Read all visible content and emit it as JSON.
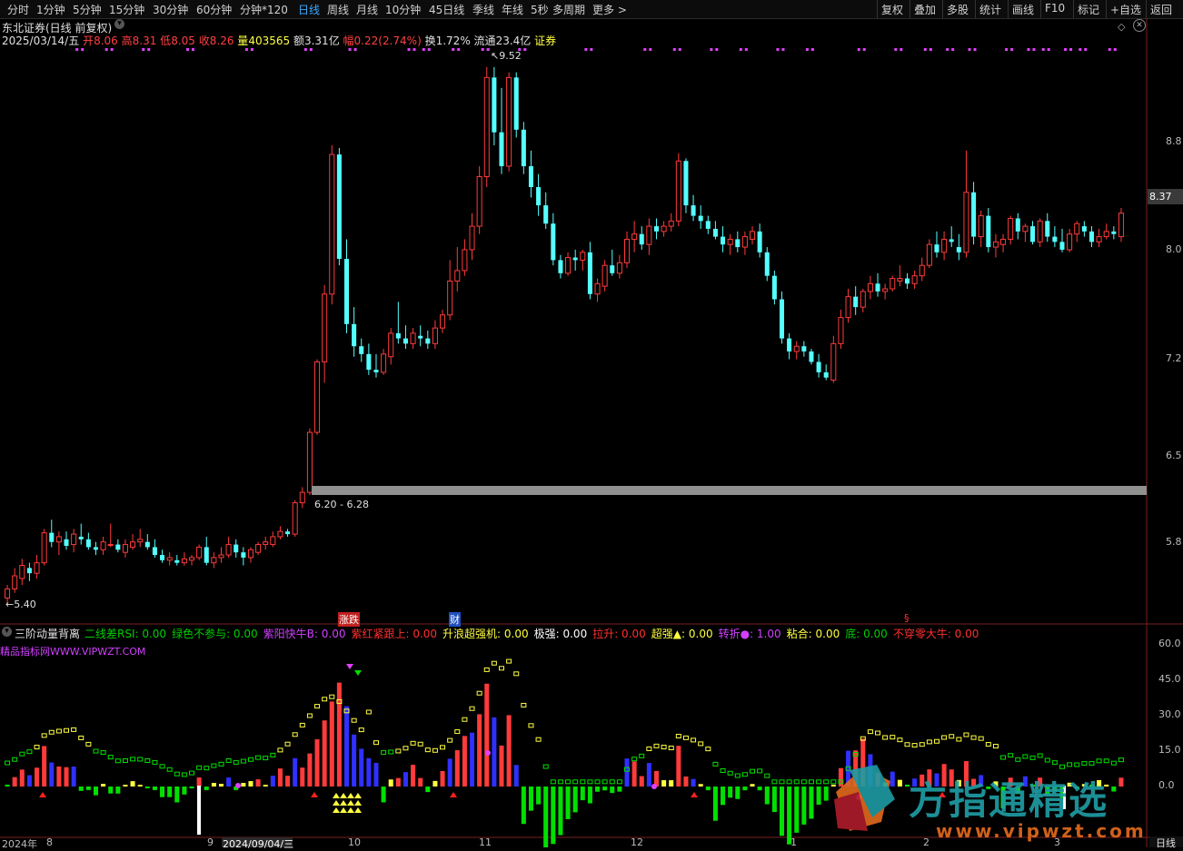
{
  "toolbar": {
    "left_items": [
      "分时",
      "1分钟",
      "5分钟",
      "15分钟",
      "30分钟",
      "60分钟",
      "分钟*120",
      "日线",
      "周线",
      "月线",
      "10分钟",
      "45日线",
      "季线",
      "年线",
      "5秒",
      "多周期",
      "更多 >"
    ],
    "active_index": 7,
    "right_items": [
      "复权",
      "叠加",
      "多股",
      "统计",
      "画线",
      "F10",
      "标记",
      "+自选",
      "返回"
    ]
  },
  "stock": {
    "title": "东北证券(日线 前复权)",
    "date": "2025/03/14/五",
    "open_label": "开",
    "open": "8.06",
    "high_label": "高",
    "high": "8.31",
    "low_label": "低",
    "low": "8.05",
    "close_label": "收",
    "close": "8.26",
    "volume_label": "量",
    "volume": "403565",
    "amount_label": "额",
    "amount": "3.31亿",
    "change_label": "幅",
    "change": "0.22(2.74%)",
    "turnover_label": "换",
    "turnover": "1.72%",
    "float_label": "流通",
    "float": "23.4亿",
    "sector": "证券"
  },
  "price_chart": {
    "type": "candlestick",
    "y_ticks": [
      "8.8",
      "8.37",
      "8.0",
      "7.2",
      "6.5",
      "5.8"
    ],
    "current_price": "8.37",
    "high_marker": "9.52",
    "low_marker": "5.40",
    "support_band": "6.20 - 6.28",
    "event_markers": [
      "涨跌",
      "财",
      "§"
    ]
  },
  "indicator": {
    "name": "三阶动量背离",
    "legend": [
      {
        "text": "二线差RSI: 0.00",
        "color": "#00d000"
      },
      {
        "text": "绿色不参与: 0.00",
        "color": "#00d000"
      },
      {
        "text": "紫阳快牛B: 0.00",
        "color": "#d040ff"
      },
      {
        "text": "紫红紧跟上: 0.00",
        "color": "#ff3030"
      },
      {
        "text": "升浪超强机: 0.00",
        "color": "#ffff40"
      },
      {
        "text": "极强: 0.00",
        "color": "#ffffff"
      },
      {
        "text": "拉升: 0.00",
        "color": "#ff3030"
      },
      {
        "text": "超强▲: 0.00",
        "color": "#ffff40"
      },
      {
        "text": "转折●: 1.00",
        "color": "#d040ff"
      },
      {
        "text": "粘合: 0.00",
        "color": "#ffff40"
      },
      {
        "text": "底: 0.00",
        "color": "#00d000"
      },
      {
        "text": "不穿零大牛: 0.00",
        "color": "#ff3030"
      }
    ],
    "watermark": "精品指标网WWW.VIPWZT.COM",
    "y_ticks": [
      "60.0",
      "45.0",
      "30.0",
      "15.0",
      "0.0"
    ]
  },
  "x_axis": {
    "labels": [
      "2024年",
      "8",
      "9",
      "2024/09/04/三",
      "10",
      "11",
      "12",
      "1",
      "2",
      "3"
    ],
    "period": "日线"
  },
  "watermark_logo": {
    "title": "方指通精选",
    "url": "www.vipwzt.com"
  },
  "colors": {
    "up": "#ff3b3b",
    "down": "#54ffff",
    "yellow": "#ffff40",
    "green": "#00e000",
    "magenta": "#e040ff",
    "blue": "#3030ff"
  },
  "chart_data": {
    "type": "candlestick",
    "ohlc": [
      [
        5.45,
        5.55,
        5.4,
        5.52
      ],
      [
        5.52,
        5.68,
        5.49,
        5.62
      ],
      [
        5.6,
        5.75,
        5.55,
        5.7
      ],
      [
        5.68,
        5.72,
        5.58,
        5.64
      ],
      [
        5.64,
        5.78,
        5.6,
        5.72
      ],
      [
        5.72,
        5.98,
        5.7,
        5.95
      ],
      [
        5.95,
        6.05,
        5.84,
        5.88
      ],
      [
        5.88,
        5.96,
        5.78,
        5.92
      ],
      [
        5.9,
        5.96,
        5.82,
        5.85
      ],
      [
        5.86,
        5.98,
        5.8,
        5.94
      ],
      [
        5.92,
        6.02,
        5.86,
        5.9
      ],
      [
        5.9,
        5.95,
        5.82,
        5.84
      ],
      [
        5.84,
        5.88,
        5.78,
        5.82
      ],
      [
        5.82,
        5.92,
        5.78,
        5.88
      ],
      [
        5.86,
        6.02,
        5.84,
        5.86
      ],
      [
        5.86,
        5.9,
        5.8,
        5.82
      ],
      [
        5.8,
        5.9,
        5.76,
        5.86
      ],
      [
        5.84,
        5.94,
        5.82,
        5.88
      ],
      [
        5.88,
        5.98,
        5.84,
        5.9
      ],
      [
        5.88,
        5.94,
        5.82,
        5.84
      ],
      [
        5.84,
        5.9,
        5.76,
        5.78
      ],
      [
        5.78,
        5.82,
        5.72,
        5.74
      ],
      [
        5.74,
        5.8,
        5.7,
        5.76
      ],
      [
        5.74,
        5.78,
        5.7,
        5.72
      ],
      [
        5.72,
        5.8,
        5.7,
        5.75
      ],
      [
        5.74,
        5.78,
        5.7,
        5.76
      ],
      [
        5.76,
        5.86,
        5.74,
        5.84
      ],
      [
        5.84,
        5.92,
        5.7,
        5.72
      ],
      [
        5.72,
        5.8,
        5.68,
        5.76
      ],
      [
        5.76,
        5.84,
        5.72,
        5.78
      ],
      [
        5.78,
        5.92,
        5.76,
        5.86
      ],
      [
        5.86,
        5.9,
        5.76,
        5.8
      ],
      [
        5.8,
        5.84,
        5.7,
        5.76
      ],
      [
        5.76,
        5.84,
        5.72,
        5.82
      ],
      [
        5.8,
        5.88,
        5.78,
        5.86
      ],
      [
        5.86,
        5.92,
        5.82,
        5.88
      ],
      [
        5.86,
        5.96,
        5.84,
        5.92
      ],
      [
        5.92,
        6.0,
        5.9,
        5.96
      ],
      [
        5.96,
        5.98,
        5.92,
        5.94
      ],
      [
        5.94,
        6.2,
        5.92,
        6.18
      ],
      [
        6.18,
        6.3,
        6.14,
        6.26
      ],
      [
        6.26,
        6.75,
        6.24,
        6.72
      ],
      [
        6.72,
        7.28,
        6.7,
        7.26
      ],
      [
        7.26,
        7.85,
        7.1,
        7.78
      ],
      [
        7.78,
        8.92,
        7.7,
        8.85
      ],
      [
        8.85,
        8.9,
        8.0,
        8.05
      ],
      [
        8.05,
        8.2,
        7.48,
        7.55
      ],
      [
        7.55,
        7.68,
        7.3,
        7.38
      ],
      [
        7.38,
        7.44,
        7.26,
        7.32
      ],
      [
        7.32,
        7.4,
        7.16,
        7.2
      ],
      [
        7.2,
        7.32,
        7.14,
        7.18
      ],
      [
        7.18,
        7.36,
        7.16,
        7.32
      ],
      [
        7.3,
        7.52,
        7.24,
        7.48
      ],
      [
        7.48,
        7.72,
        7.4,
        7.44
      ],
      [
        7.44,
        7.54,
        7.36,
        7.4
      ],
      [
        7.4,
        7.52,
        7.36,
        7.48
      ],
      [
        7.46,
        7.54,
        7.38,
        7.44
      ],
      [
        7.44,
        7.5,
        7.36,
        7.4
      ],
      [
        7.4,
        7.58,
        7.36,
        7.52
      ],
      [
        7.52,
        7.66,
        7.48,
        7.62
      ],
      [
        7.62,
        8.04,
        7.58,
        7.88
      ],
      [
        7.88,
        8.14,
        7.8,
        7.96
      ],
      [
        7.96,
        8.2,
        7.92,
        8.12
      ],
      [
        8.12,
        8.4,
        8.04,
        8.3
      ],
      [
        8.3,
        8.76,
        8.24,
        8.68
      ],
      [
        8.68,
        9.52,
        8.6,
        9.44
      ],
      [
        9.44,
        9.52,
        8.92,
        9.02
      ],
      [
        9.02,
        9.36,
        8.7,
        8.76
      ],
      [
        8.76,
        9.48,
        8.72,
        9.44
      ],
      [
        9.44,
        9.48,
        8.98,
        9.04
      ],
      [
        9.04,
        9.1,
        8.7,
        8.76
      ],
      [
        8.76,
        8.88,
        8.52,
        8.6
      ],
      [
        8.6,
        8.7,
        8.38,
        8.46
      ],
      [
        8.46,
        8.56,
        8.28,
        8.32
      ],
      [
        8.32,
        8.4,
        8.0,
        8.04
      ],
      [
        8.04,
        8.08,
        7.9,
        7.94
      ],
      [
        7.94,
        8.1,
        7.92,
        8.06
      ],
      [
        8.06,
        8.12,
        7.96,
        8.04
      ],
      [
        8.04,
        8.12,
        7.96,
        8.1
      ],
      [
        8.1,
        8.18,
        7.74,
        7.78
      ],
      [
        7.78,
        7.9,
        7.72,
        7.86
      ],
      [
        7.84,
        8.04,
        7.8,
        8.0
      ],
      [
        8.0,
        8.12,
        7.92,
        7.94
      ],
      [
        7.94,
        8.08,
        7.9,
        8.02
      ],
      [
        8.02,
        8.26,
        7.98,
        8.2
      ],
      [
        8.2,
        8.34,
        8.1,
        8.24
      ],
      [
        8.24,
        8.3,
        8.12,
        8.16
      ],
      [
        8.16,
        8.36,
        8.08,
        8.3
      ],
      [
        8.3,
        8.36,
        8.2,
        8.26
      ],
      [
        8.26,
        8.34,
        8.22,
        8.3
      ],
      [
        8.3,
        8.4,
        8.26,
        8.34
      ],
      [
        8.34,
        8.86,
        8.3,
        8.8
      ],
      [
        8.8,
        8.82,
        8.4,
        8.46
      ],
      [
        8.46,
        8.54,
        8.34,
        8.38
      ],
      [
        8.38,
        8.46,
        8.28,
        8.34
      ],
      [
        8.34,
        8.38,
        8.24,
        8.28
      ],
      [
        8.28,
        8.34,
        8.2,
        8.22
      ],
      [
        8.22,
        8.3,
        8.1,
        8.16
      ],
      [
        8.16,
        8.24,
        8.08,
        8.2
      ],
      [
        8.2,
        8.26,
        8.1,
        8.14
      ],
      [
        8.14,
        8.26,
        8.08,
        8.22
      ],
      [
        8.2,
        8.3,
        8.16,
        8.26
      ],
      [
        8.26,
        8.32,
        8.06,
        8.1
      ],
      [
        8.1,
        8.14,
        7.88,
        7.92
      ],
      [
        7.92,
        7.96,
        7.7,
        7.74
      ],
      [
        7.74,
        7.8,
        7.4,
        7.44
      ],
      [
        7.44,
        7.48,
        7.28,
        7.34
      ],
      [
        7.34,
        7.42,
        7.28,
        7.38
      ],
      [
        7.38,
        7.42,
        7.3,
        7.34
      ],
      [
        7.34,
        7.36,
        7.24,
        7.26
      ],
      [
        7.26,
        7.32,
        7.14,
        7.18
      ],
      [
        7.18,
        7.24,
        7.12,
        7.14
      ],
      [
        7.12,
        7.46,
        7.1,
        7.4
      ],
      [
        7.4,
        7.66,
        7.36,
        7.6
      ],
      [
        7.6,
        7.82,
        7.56,
        7.76
      ],
      [
        7.76,
        7.84,
        7.62,
        7.68
      ],
      [
        7.68,
        7.82,
        7.64,
        7.8
      ],
      [
        7.8,
        7.92,
        7.74,
        7.86
      ],
      [
        7.86,
        7.94,
        7.76,
        7.8
      ],
      [
        7.8,
        7.86,
        7.74,
        7.82
      ],
      [
        7.82,
        7.92,
        7.8,
        7.9
      ],
      [
        7.88,
        8.0,
        7.84,
        7.9
      ],
      [
        7.9,
        7.94,
        7.82,
        7.86
      ],
      [
        7.86,
        7.96,
        7.82,
        7.92
      ],
      [
        7.92,
        8.06,
        7.88,
        8.0
      ],
      [
        8.0,
        8.2,
        7.98,
        8.16
      ],
      [
        8.16,
        8.26,
        8.06,
        8.1
      ],
      [
        8.1,
        8.26,
        8.04,
        8.2
      ],
      [
        8.2,
        8.3,
        8.14,
        8.18
      ],
      [
        8.14,
        8.24,
        8.04,
        8.1
      ],
      [
        8.1,
        8.88,
        8.06,
        8.56
      ],
      [
        8.56,
        8.64,
        8.16,
        8.22
      ],
      [
        8.22,
        8.42,
        8.14,
        8.38
      ],
      [
        8.38,
        8.44,
        8.1,
        8.14
      ],
      [
        8.14,
        8.24,
        8.06,
        8.18
      ],
      [
        8.16,
        8.24,
        8.1,
        8.2
      ],
      [
        8.2,
        8.38,
        8.16,
        8.36
      ],
      [
        8.36,
        8.4,
        8.2,
        8.26
      ],
      [
        8.26,
        8.32,
        8.18,
        8.3
      ],
      [
        8.3,
        8.34,
        8.16,
        8.18
      ],
      [
        8.18,
        8.36,
        8.14,
        8.34
      ],
      [
        8.34,
        8.4,
        8.18,
        8.22
      ],
      [
        8.22,
        8.3,
        8.14,
        8.18
      ],
      [
        8.18,
        8.28,
        8.1,
        8.12
      ],
      [
        8.12,
        8.28,
        8.1,
        8.24
      ],
      [
        8.24,
        8.34,
        8.18,
        8.32
      ],
      [
        8.3,
        8.34,
        8.22,
        8.26
      ],
      [
        8.26,
        8.3,
        8.14,
        8.18
      ],
      [
        8.18,
        8.28,
        8.14,
        8.22
      ],
      [
        8.22,
        8.32,
        8.2,
        8.26
      ],
      [
        8.26,
        8.3,
        8.2,
        8.24
      ],
      [
        8.22,
        8.44,
        8.18,
        8.4
      ]
    ],
    "y_range": [
      5.3,
      9.7
    ]
  }
}
